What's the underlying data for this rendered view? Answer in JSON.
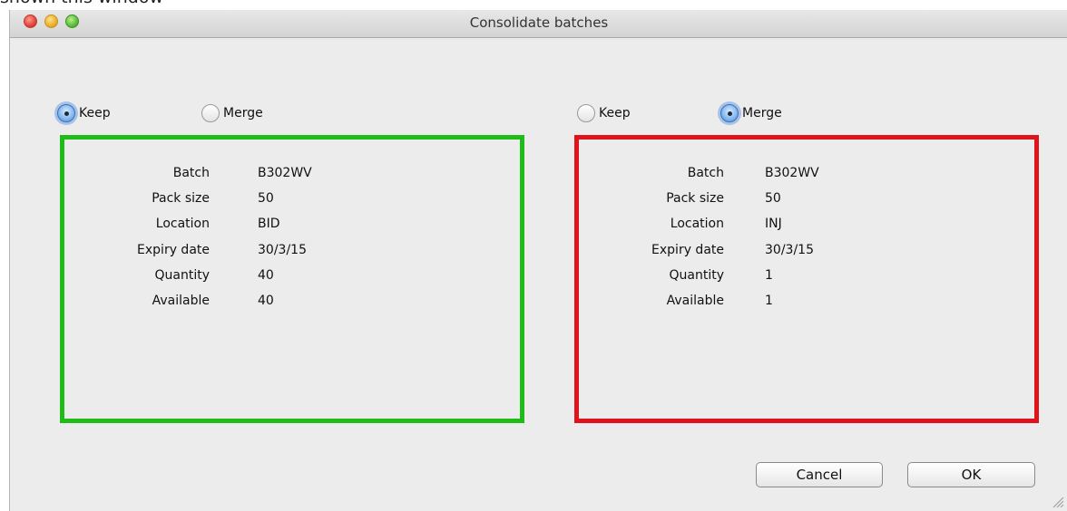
{
  "document": {
    "partial_text": "shown this window"
  },
  "window": {
    "title": "Consolidate batches"
  },
  "left": {
    "options": {
      "keep": "Keep",
      "merge": "Merge",
      "selected": "keep"
    },
    "accent": "#1fbb18",
    "fields": [
      {
        "label": "Batch",
        "value": "B302WV"
      },
      {
        "label": "Pack size",
        "value": "50"
      },
      {
        "label": "Location",
        "value": "BID"
      },
      {
        "label": "Expiry date",
        "value": "30/3/15"
      },
      {
        "label": "Quantity",
        "value": "40"
      },
      {
        "label": "Available",
        "value": "40"
      }
    ]
  },
  "right": {
    "options": {
      "keep": "Keep",
      "merge": "Merge",
      "selected": "merge"
    },
    "accent": "#e0131c",
    "fields": [
      {
        "label": "Batch",
        "value": "B302WV"
      },
      {
        "label": "Pack size",
        "value": "50"
      },
      {
        "label": "Location",
        "value": "INJ"
      },
      {
        "label": "Expiry date",
        "value": "30/3/15"
      },
      {
        "label": "Quantity",
        "value": "1"
      },
      {
        "label": "Available",
        "value": "1"
      }
    ]
  },
  "buttons": {
    "cancel": "Cancel",
    "ok": "OK"
  }
}
